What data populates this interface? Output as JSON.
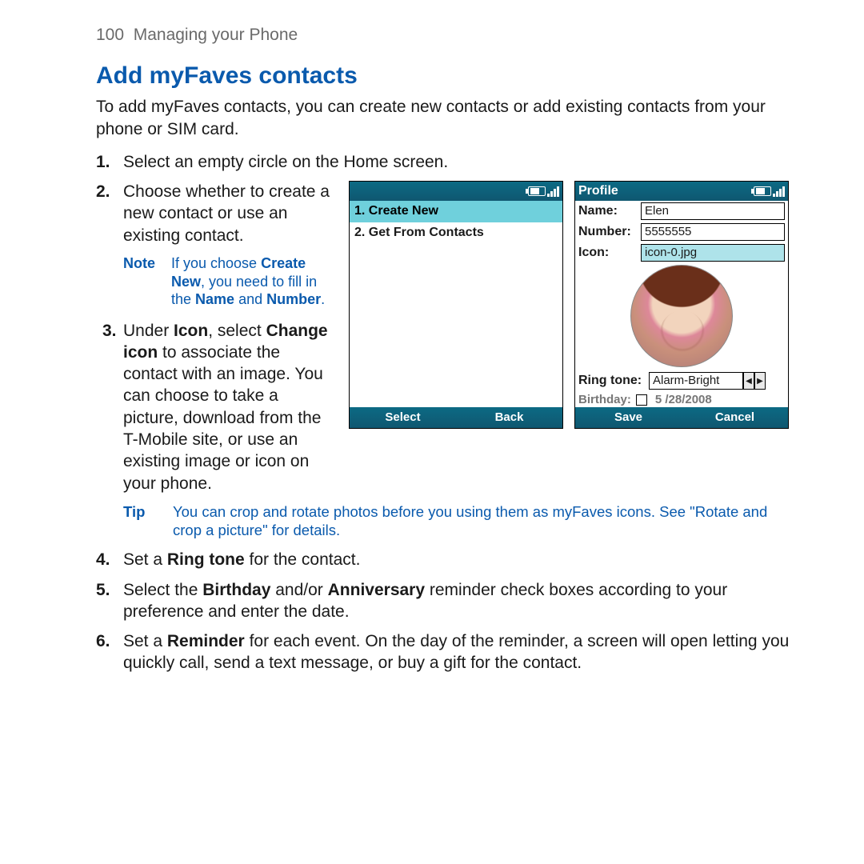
{
  "header": {
    "page_number": "100",
    "chapter": "Managing your Phone"
  },
  "section": {
    "title": "Add myFaves contacts",
    "intro": "To add myFaves contacts, you can create new contacts or add existing contacts from your phone or SIM card."
  },
  "steps": {
    "s1": {
      "num": "1.",
      "text": "Select an empty circle on the Home screen."
    },
    "s2": {
      "num": "2.",
      "text": "Choose whether to create a new contact or use an existing contact."
    },
    "s2_note": {
      "label": "Note",
      "pre": "If you choose ",
      "b1": "Create New",
      "mid": ", you need to fill in the ",
      "b2": "Name",
      "and": " and ",
      "b3": "Number",
      "end": "."
    },
    "s3": {
      "num": "3.",
      "pre": "Under ",
      "b1": "Icon",
      "mid": ", select ",
      "b2": "Change icon",
      "post": " to associate the contact with an image. You can choose to take a picture, download from the T-Mobile site, or use an existing image or icon on your phone."
    },
    "tip": {
      "label": "Tip",
      "text": "You can crop and rotate photos before you using them as myFaves icons. See \"Rotate and crop a picture\" for details."
    },
    "s4": {
      "num": "4.",
      "pre": "Set a ",
      "b1": "Ring tone",
      "post": " for the contact."
    },
    "s5": {
      "num": "5.",
      "pre": "Select the ",
      "b1": "Birthday",
      "mid": " and/or ",
      "b2": "Anniversary",
      "post": " reminder check boxes according to your preference and enter the date."
    },
    "s6": {
      "num": "6.",
      "pre": "Set a ",
      "b1": "Reminder",
      "post": " for each event. On the day of the reminder, a screen will open letting you quickly call, send a text message, or buy a gift for the contact."
    }
  },
  "screen1": {
    "menu": {
      "item1": "1.  Create New",
      "item2": "2.  Get From Contacts"
    },
    "softkeys": {
      "left": "Select",
      "right": "Back"
    }
  },
  "screen2": {
    "title": "Profile",
    "labels": {
      "name": "Name:",
      "number": "Number:",
      "icon": "Icon:",
      "ringtone": "Ring tone:",
      "birthday": "Birthday:"
    },
    "values": {
      "name": "Elen",
      "number": "5555555",
      "icon": "icon-0.jpg",
      "ringtone": "Alarm-Bright",
      "birthday": "5 /28/2008"
    },
    "softkeys": {
      "left": "Save",
      "right": "Cancel"
    }
  }
}
